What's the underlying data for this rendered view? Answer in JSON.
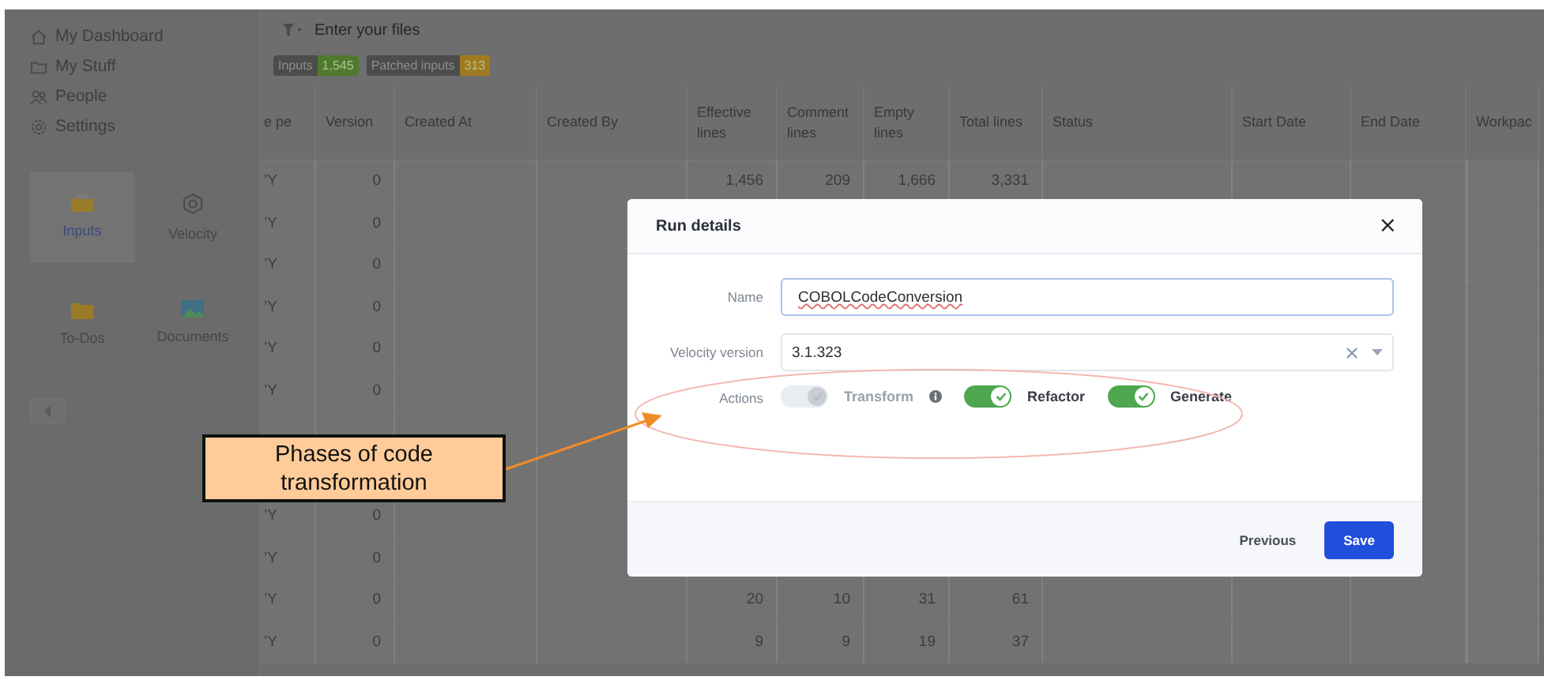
{
  "sidebar": {
    "nav": [
      {
        "label": "My Dashboard"
      },
      {
        "label": "My Stuff"
      },
      {
        "label": "People"
      },
      {
        "label": "Settings"
      }
    ],
    "tiles": [
      {
        "label": "Inputs",
        "selected": true
      },
      {
        "label": "Velocity",
        "selected": false
      },
      {
        "label": "To-Dos",
        "selected": false
      },
      {
        "label": "Documents",
        "selected": false
      }
    ]
  },
  "filter": {
    "placeholder": "Enter your files"
  },
  "badges": [
    {
      "label": "Inputs",
      "count": "1,545",
      "color": "#4f7a2e"
    },
    {
      "label": "Patched inputs",
      "count": "313",
      "color": "#a07a20"
    }
  ],
  "table": {
    "columns": [
      "e pe",
      "Version",
      "Created At",
      "Created By",
      "Effective lines",
      "Comment lines",
      "Empty lines",
      "Total lines",
      "Status",
      "Start Date",
      "End Date",
      "Workpac"
    ],
    "rows": [
      [
        "’Y",
        "0",
        null,
        null,
        "1,456",
        "209",
        "1,666",
        "3,331",
        null,
        null,
        null,
        null
      ],
      [
        "’Y",
        "0",
        null,
        null,
        null,
        null,
        null,
        null,
        null,
        null,
        null,
        null
      ],
      [
        "’Y",
        "0",
        null,
        null,
        null,
        null,
        null,
        null,
        null,
        null,
        null,
        null
      ],
      [
        "’Y",
        "0",
        null,
        null,
        null,
        null,
        null,
        null,
        null,
        null,
        null,
        null
      ],
      [
        "’Y",
        "0",
        null,
        null,
        null,
        null,
        null,
        null,
        null,
        null,
        null,
        null
      ],
      [
        "’Y",
        "0",
        null,
        null,
        null,
        null,
        null,
        null,
        null,
        null,
        null,
        null
      ],
      [
        null,
        null,
        null,
        null,
        null,
        null,
        null,
        null,
        null,
        null,
        null,
        null
      ],
      [
        null,
        null,
        null,
        null,
        null,
        null,
        null,
        null,
        null,
        null,
        null,
        null
      ],
      [
        "’Y",
        "0",
        null,
        null,
        null,
        null,
        null,
        null,
        null,
        null,
        null,
        null
      ],
      [
        "’Y",
        "0",
        null,
        null,
        null,
        null,
        null,
        null,
        null,
        null,
        null,
        null
      ],
      [
        "’Y",
        "0",
        null,
        null,
        "20",
        "10",
        "31",
        "61",
        null,
        null,
        null,
        null
      ],
      [
        "’Y",
        "0",
        null,
        null,
        "9",
        "9",
        "19",
        "37",
        null,
        null,
        null,
        null
      ]
    ]
  },
  "dialog": {
    "title": "Run details",
    "close": "×",
    "fields": [
      {
        "label": "Name",
        "value": "COBOLCodeConversion",
        "kind": "text",
        "focused": true,
        "misspelled": true
      },
      {
        "label": "Velocity version",
        "value": "3.1.323",
        "kind": "select",
        "focused": false,
        "misspelled": false
      }
    ],
    "actions": {
      "label": "Actions",
      "toggles": [
        {
          "label": "Transform",
          "on": true,
          "disabled": true,
          "info": true
        },
        {
          "label": "Refactor",
          "on": true,
          "disabled": false,
          "info": false
        },
        {
          "label": "Generate",
          "on": true,
          "disabled": false,
          "info": false
        }
      ]
    },
    "buttons": [
      {
        "label": "Previous",
        "kind": "secondary"
      },
      {
        "label": "Save",
        "kind": "primary"
      }
    ]
  },
  "callout": {
    "text": "Phases of code transformation"
  }
}
